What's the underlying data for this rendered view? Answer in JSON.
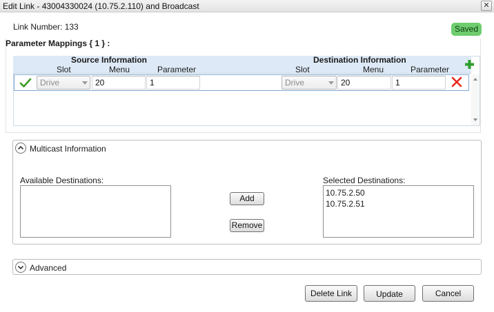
{
  "window": {
    "title": "Edit Link -  43004330024 (10.75.2.110) and Broadcast",
    "close_glyph": "✕"
  },
  "link": {
    "number_label": "Link Number: 133",
    "status": "Saved",
    "status_color": "#6fcc6f"
  },
  "mappings": {
    "heading": "Parameter Mappings { 1 } :",
    "source_group": "Source Information",
    "destination_group": "Destination Information",
    "columns": {
      "slot": "Slot",
      "menu": "Menu",
      "parameter": "Parameter"
    },
    "rows": [
      {
        "status_icon": "check-icon",
        "source": {
          "slot": "Drive",
          "menu": "20",
          "parameter": "1"
        },
        "destination": {
          "slot": "Drive",
          "menu": "20",
          "parameter": "1"
        },
        "delete_icon": "delete-x-icon"
      }
    ],
    "add_icon": "plus-icon"
  },
  "multicast": {
    "title": "Multicast Information",
    "available_label": "Available Destinations:",
    "selected_label": "Selected Destinations:",
    "available": [],
    "selected": [
      "10.75.2.50",
      "10.75.2.51"
    ],
    "add_button": "Add",
    "remove_button": "Remove"
  },
  "advanced": {
    "title": "Advanced"
  },
  "footer": {
    "delete_button": "Delete Link",
    "update_button": "Update",
    "cancel_button": "Cancel"
  },
  "colors": {
    "grid_header": "#dde9f6",
    "row_border": "#7fa8d6",
    "delete": "#e8271d",
    "add": "#2e9e2e",
    "check": "#3a9a23"
  }
}
